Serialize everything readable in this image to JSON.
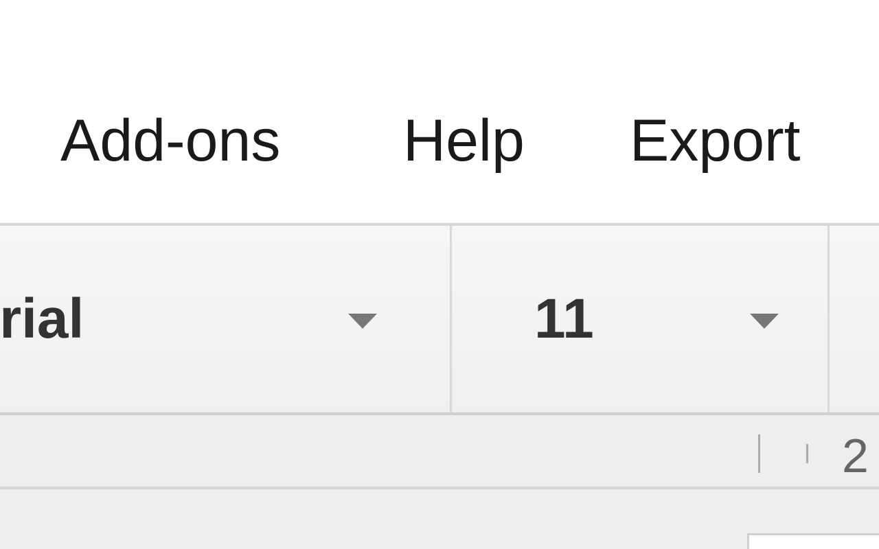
{
  "menubar": {
    "items": [
      {
        "label": "Add-ons"
      },
      {
        "label": "Help"
      },
      {
        "label": "Export"
      }
    ]
  },
  "toolbar": {
    "font": {
      "value": "Arial",
      "visible_text": "rial"
    },
    "font_size": {
      "value": "11"
    }
  },
  "ruler": {
    "number": "2"
  },
  "colors": {
    "menu_text": "#1a1a1a",
    "toolbar_bg": "#f2f2f2",
    "ruler_bg": "#eeeeee",
    "caret": "#777777"
  },
  "icons": {
    "dropdown": "chevron-down-icon"
  }
}
